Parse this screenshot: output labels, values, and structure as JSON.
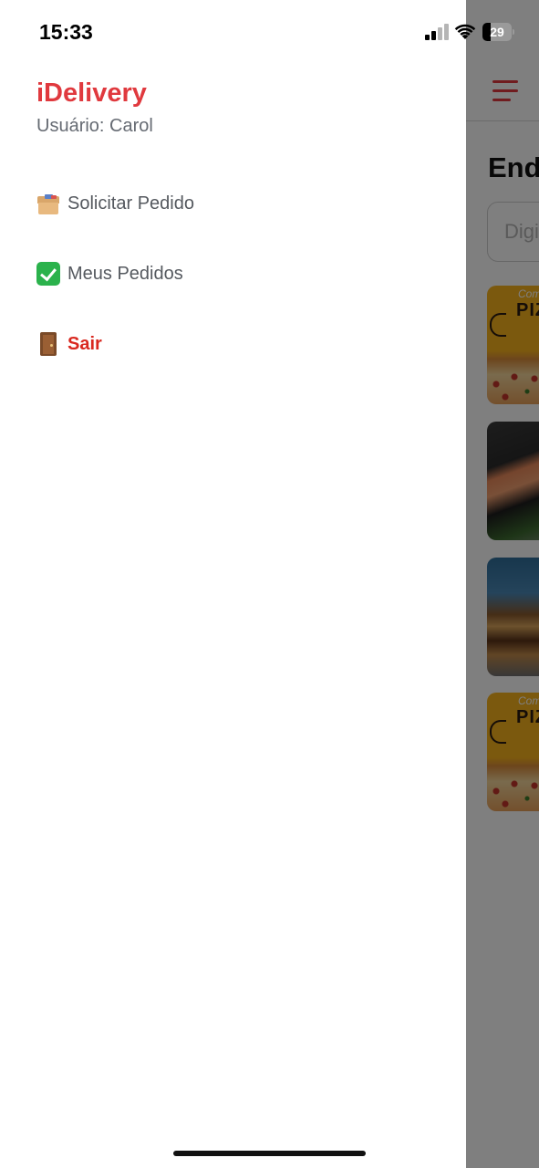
{
  "status_bar": {
    "time": "15:33",
    "battery_level": "29",
    "battery_fraction": 0.29,
    "signal_bars_active": 2,
    "signal_bars_total": 4
  },
  "drawer": {
    "title": "iDelivery",
    "user_label": "Usuário: Carol",
    "items": [
      {
        "label": "Solicitar Pedido",
        "icon": "package-icon"
      },
      {
        "label": "Meus Pedidos",
        "icon": "check-mark-icon"
      },
      {
        "label": "Sair",
        "icon": "door-icon"
      }
    ]
  },
  "background_screen": {
    "section_title_partial": "End",
    "address_placeholder_partial": "Digi",
    "menu_icon": "hamburger-menu-icon",
    "cards": [
      {
        "kind": "pizza-promo",
        "headline_partial": "PIZ",
        "script_partial": "Com"
      },
      {
        "kind": "sushi-photo"
      },
      {
        "kind": "burger-photo"
      },
      {
        "kind": "pizza-promo",
        "headline_partial": "PIZ",
        "script_partial": "Com"
      }
    ]
  },
  "colors": {
    "brand_red": "#e0393e",
    "logout_red": "#d9281f",
    "muted_text": "#666b73",
    "overlay": "rgba(0,0,0,0.5)"
  }
}
